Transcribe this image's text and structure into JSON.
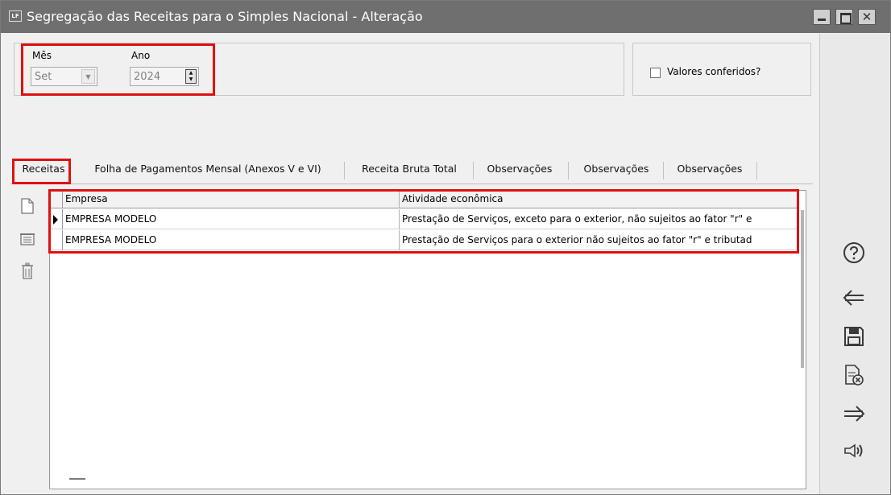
{
  "window": {
    "title": "Segregação das Receitas para o Simples Nacional - Alteração",
    "app_icon_text": "LF"
  },
  "header": {
    "month_label": "Mês",
    "month_value": "Set",
    "year_label": "Ano",
    "year_value": "2024",
    "checked_label": "Valores conferidos?"
  },
  "tabs": [
    {
      "label": "Receitas"
    },
    {
      "label": "Folha de Pagamentos Mensal (Anexos V e VI)"
    },
    {
      "label": "Receita Bruta Total"
    },
    {
      "label": "Observações"
    },
    {
      "label": "Observações"
    },
    {
      "label": "Observações"
    }
  ],
  "grid": {
    "columns": [
      "Empresa",
      "Atividade econômica"
    ],
    "rows": [
      {
        "empresa": "EMPRESA MODELO",
        "atividade": "Prestação de Serviços, exceto para o exterior, não sujeitos ao fator \"r\" e"
      },
      {
        "empresa": "EMPRESA MODELO",
        "atividade": "Prestação de Serviços para o exterior não sujeitos ao fator \"r\" e tributad"
      }
    ]
  },
  "icons": {
    "left_toolbar": [
      "new-document-icon",
      "copy-icon",
      "trash-icon"
    ],
    "right_toolbar": [
      "help-icon",
      "back-arrow-icon",
      "save-icon",
      "cancel-document-icon",
      "forward-arrow-icon",
      "speaker-icon"
    ]
  },
  "colors": {
    "titlebar": "#6f6f6f",
    "highlight": "#e01010"
  }
}
